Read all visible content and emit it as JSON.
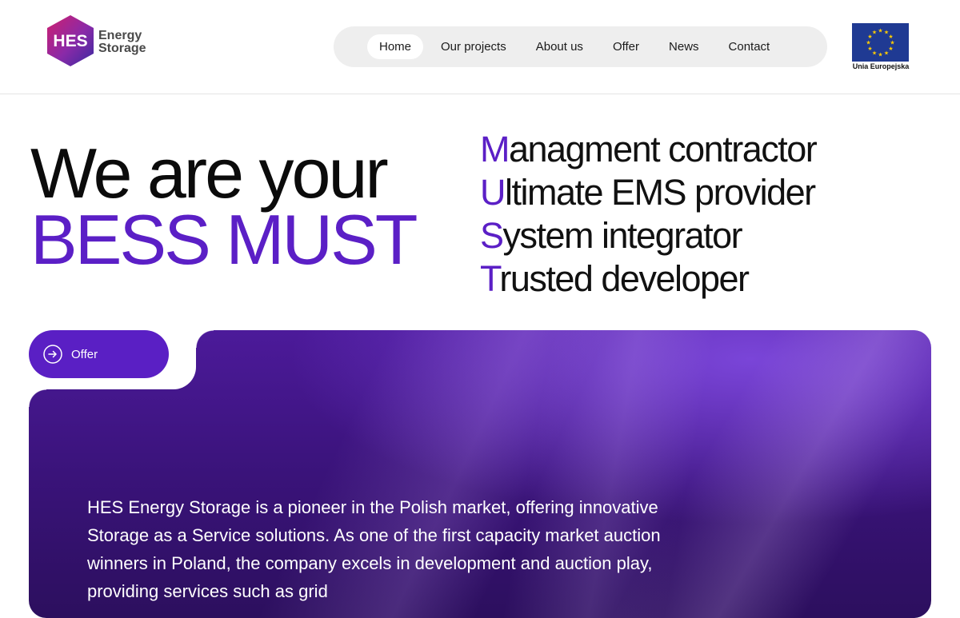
{
  "logo": {
    "mark": "HES",
    "line1": "Energy",
    "line2": "Storage"
  },
  "nav": {
    "items": [
      {
        "label": "Home",
        "active": true
      },
      {
        "label": "Our projects"
      },
      {
        "label": "About us"
      },
      {
        "label": "Offer"
      },
      {
        "label": "News"
      },
      {
        "label": "Contact"
      }
    ]
  },
  "eu": {
    "label": "Unia Europejska",
    "icon": "eu-flag-icon"
  },
  "hero": {
    "line1": "We are your",
    "line2": "BESS MUST",
    "roles": [
      {
        "initial": "M",
        "rest": "anagment contractor"
      },
      {
        "initial": "U",
        "rest": "ltimate EMS provider"
      },
      {
        "initial": "S",
        "rest": "ystem integrator"
      },
      {
        "initial": "T",
        "rest": "rusted developer"
      }
    ]
  },
  "offer_button": {
    "label": "Offer",
    "icon": "arrow-right-circle-icon"
  },
  "panel": {
    "text": "HES Energy Storage is a pioneer in the Polish market, offering innovative Storage as a Service solutions. As one of the first capacity market auction winners in Poland, the company excels in development and auction play, providing services such as grid"
  },
  "colors": {
    "accent": "#5b1fc6",
    "nav_bg": "#eeeeee",
    "eu_blue": "#1f3a93",
    "eu_star": "#ffcc00"
  }
}
